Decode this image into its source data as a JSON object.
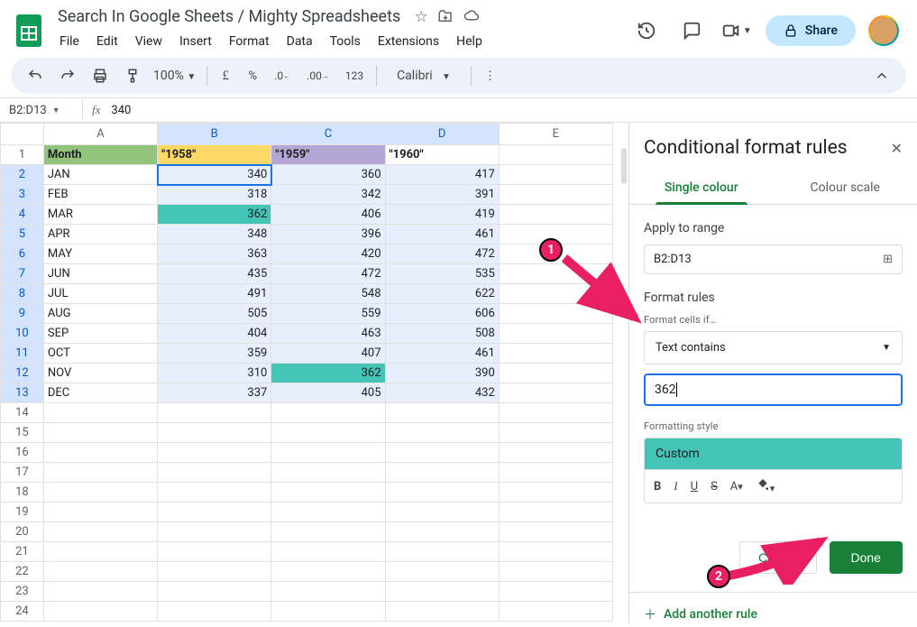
{
  "header": {
    "doc_title": "Search In Google Sheets / Mighty Spreadsheets",
    "menu": [
      "File",
      "Edit",
      "View",
      "Insert",
      "Format",
      "Data",
      "Tools",
      "Extensions",
      "Help"
    ],
    "share_label": "Share"
  },
  "toolbar": {
    "zoom": "100%",
    "font": "Calibri"
  },
  "formula_bar": {
    "namebox": "B2:D13",
    "value": "340"
  },
  "columns": [
    "A",
    "B",
    "C",
    "D",
    "E"
  ],
  "sheet": {
    "headers": {
      "A": "Month",
      "B": "\"1958\"",
      "C": "\"1959\"",
      "D": "\"1960\""
    },
    "rows": [
      {
        "m": "JAN",
        "b": "340",
        "c": "360",
        "d": "417"
      },
      {
        "m": "FEB",
        "b": "318",
        "c": "342",
        "d": "391"
      },
      {
        "m": "MAR",
        "b": "362",
        "c": "406",
        "d": "419"
      },
      {
        "m": "APR",
        "b": "348",
        "c": "396",
        "d": "461"
      },
      {
        "m": "MAY",
        "b": "363",
        "c": "420",
        "d": "472"
      },
      {
        "m": "JUN",
        "b": "435",
        "c": "472",
        "d": "535"
      },
      {
        "m": "JUL",
        "b": "491",
        "c": "548",
        "d": "622"
      },
      {
        "m": "AUG",
        "b": "505",
        "c": "559",
        "d": "606"
      },
      {
        "m": "SEP",
        "b": "404",
        "c": "463",
        "d": "508"
      },
      {
        "m": "OCT",
        "b": "359",
        "c": "407",
        "d": "461"
      },
      {
        "m": "NOV",
        "b": "310",
        "c": "362",
        "d": "390"
      },
      {
        "m": "DEC",
        "b": "337",
        "c": "405",
        "d": "432"
      }
    ]
  },
  "sidepanel": {
    "title": "Conditional format rules",
    "tab_single": "Single colour",
    "tab_scale": "Colour scale",
    "apply_range_label": "Apply to range",
    "range_value": "B2:D13",
    "format_rules_label": "Format rules",
    "format_if_label": "Format cells if…",
    "condition": "Text contains",
    "value": "362",
    "formatting_style_label": "Formatting style",
    "style_name": "Custom",
    "cancel": "Cancel",
    "done": "Done",
    "add_rule": "Add another rule"
  },
  "annotations": {
    "one": "1",
    "two": "2"
  }
}
